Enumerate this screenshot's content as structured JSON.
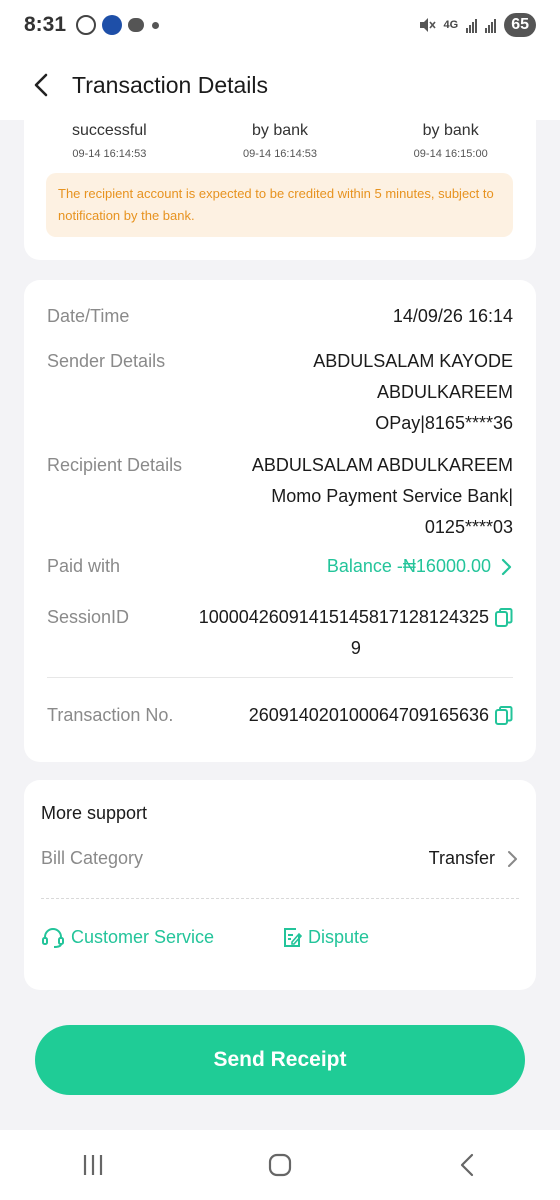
{
  "status_bar": {
    "time": "8:31",
    "network": "4G",
    "battery": "65"
  },
  "header": {
    "title": "Transaction Details"
  },
  "progress": {
    "steps": [
      {
        "status": "successful",
        "time": "09-14 16:14:53"
      },
      {
        "status": "by bank",
        "time": "09-14 16:14:53"
      },
      {
        "status": "by bank",
        "time": "09-14 16:15:00"
      }
    ],
    "notice": "The recipient account is expected to be credited within 5 minutes, subject to notification by the bank."
  },
  "details": {
    "datetime_label": "Date/Time",
    "datetime_value": "14/09/26 16:14",
    "sender_label": "Sender Details",
    "sender_line1": "ABDULSALAM KAYODE",
    "sender_line2": "ABDULKAREEM",
    "sender_line3": "OPay|8165****36",
    "recipient_label": "Recipient Details",
    "recipient_line1": "ABDULSALAM ABDULKAREEM",
    "recipient_line2": "Momo Payment Service Bank|",
    "recipient_line3": "0125****03",
    "paid_label": "Paid with",
    "paid_value": "Balance -₦16000.00",
    "session_label": "SessionID",
    "session_line1": "10000426091415145817128124325",
    "session_line2": "9",
    "txn_label": "Transaction No.",
    "txn_value": "260914020100064709165636"
  },
  "support": {
    "title": "More support",
    "bill_label": "Bill Category",
    "bill_value": "Transfer",
    "customer_service": "Customer Service",
    "dispute": "Dispute"
  },
  "send_receipt": "Send Receipt",
  "colors": {
    "accent": "#1fcc96",
    "accent_text": "#23c49a",
    "notice_bg": "#fdf1e2",
    "notice_text": "#e79320"
  }
}
